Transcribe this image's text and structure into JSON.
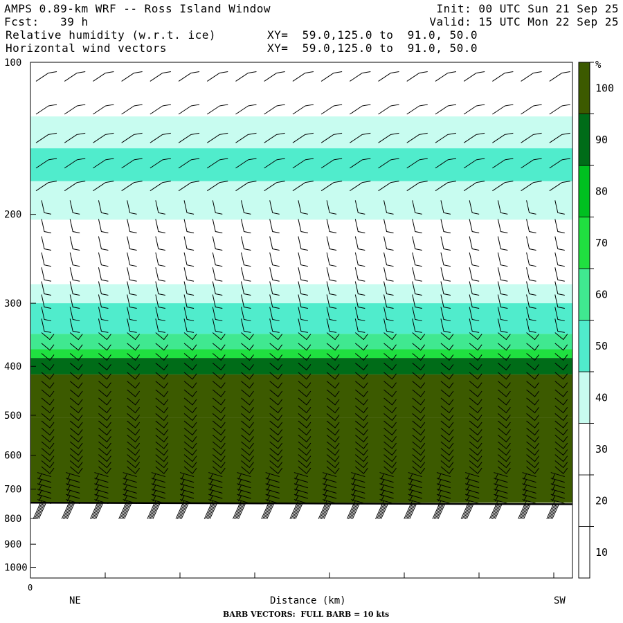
{
  "header": {
    "line1_left": "AMPS 0.89-km WRF -- Ross Island Window",
    "line1_right": "Init: 00 UTC Sun 21 Sep 25",
    "line2_left": "Fcst:   39 h",
    "line2_right": "Valid: 15 UTC Mon 22 Sep 25",
    "line3_left": "Relative humidity (w.r.t. ice)",
    "line3_mid": "XY=  59.0,125.0 to  91.0, 50.0",
    "line4_left": "Horizontal wind vectors",
    "line4_mid": "XY=  59.0,125.0 to  91.0, 50.0"
  },
  "footer": {
    "x_origin": "0",
    "left_end": "NE",
    "right_end": "SW",
    "xlabel": "Distance (km)",
    "barb_note": "BARB VECTORS:  FULL BARB = 10 kts"
  },
  "chart_data": {
    "type": "heatmap",
    "title": "Relative humidity (w.r.t. ice)",
    "xlabel": "Distance (km)",
    "ylabel": "",
    "y_ticks": [
      "100",
      "200",
      "300",
      "400",
      "500",
      "600",
      "700",
      "800",
      "900",
      "1000"
    ],
    "ylim": [
      100,
      1050
    ],
    "y_scale": "log",
    "colorbar": {
      "unit": "%",
      "ticks": [
        "10",
        "20",
        "30",
        "40",
        "50",
        "60",
        "70",
        "80",
        "90",
        "100"
      ],
      "colors": [
        "#ffffff",
        "#ffffff",
        "#ffffff",
        "#c8fcf0",
        "#50eccc",
        "#40e890",
        "#20e040",
        "#00c020",
        "#006c18",
        "#3c5a00"
      ]
    },
    "rh_layers": [
      {
        "p_top": 100,
        "p_bottom": 128,
        "rh": 15
      },
      {
        "p_top": 128,
        "p_bottom": 148,
        "rh": 35
      },
      {
        "p_top": 148,
        "p_bottom": 172,
        "rh": 45
      },
      {
        "p_top": 172,
        "p_bottom": 205,
        "rh": 35
      },
      {
        "p_top": 205,
        "p_bottom": 275,
        "rh": 15
      },
      {
        "p_top": 275,
        "p_bottom": 300,
        "rh": 35
      },
      {
        "p_top": 300,
        "p_bottom": 345,
        "rh": 45
      },
      {
        "p_top": 345,
        "p_bottom": 370,
        "rh": 55
      },
      {
        "p_top": 370,
        "p_bottom": 385,
        "rh": 65
      },
      {
        "p_top": 385,
        "p_bottom": 415,
        "rh": 85
      },
      {
        "p_top": 415,
        "p_bottom": 505,
        "rh": 95
      },
      {
        "p_top": 505,
        "p_bottom": 745,
        "rh": 105
      }
    ],
    "terrain_pressure": {
      "start": 745,
      "end": 750
    },
    "barb_columns": 19
  }
}
